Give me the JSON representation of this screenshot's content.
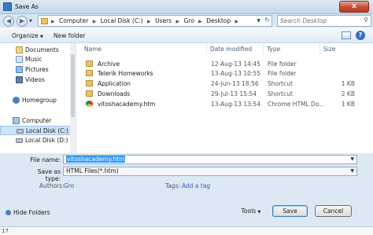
{
  "window": {
    "title": "Save As",
    "close_label": "x"
  },
  "address": {
    "crumbs": [
      "Computer",
      "Local Disk (C:)",
      "Users",
      "Gro",
      "Desktop"
    ],
    "search_placeholder": "Search Desktop"
  },
  "toolbar": {
    "organize_label": "Organize",
    "new_folder_label": "New folder",
    "help_label": "?"
  },
  "sidebar": {
    "items": [
      {
        "label": "Documents",
        "icon": "documents-icon"
      },
      {
        "label": "Music",
        "icon": "music-icon"
      },
      {
        "label": "Pictures",
        "icon": "pictures-icon"
      },
      {
        "label": "Videos",
        "icon": "videos-icon"
      },
      {
        "label": "Homegroup",
        "icon": "homegroup-icon"
      },
      {
        "label": "Computer",
        "icon": "computer-icon"
      },
      {
        "label": "Local Disk (C:)",
        "icon": "drive-icon"
      },
      {
        "label": "Local Disk (D:)",
        "icon": "drive-icon"
      }
    ]
  },
  "filelist": {
    "columns": [
      "Name",
      "Date modified",
      "Type",
      "Size"
    ],
    "rows": [
      {
        "name": "Archive",
        "date": "12-Aug-13 14:45",
        "type": "File folder",
        "size": "",
        "icon": "folder-icon"
      },
      {
        "name": "Telerik Homeworks",
        "date": "13-Aug-13 10:55",
        "type": "File folder",
        "size": "",
        "icon": "folder-icon"
      },
      {
        "name": "Application",
        "date": "24-Jun-13 18:56",
        "type": "Shortcut",
        "size": "1 KB",
        "icon": "shortcut-icon"
      },
      {
        "name": "Downloads",
        "date": "29-Jul-13 15:54",
        "type": "Shortcut",
        "size": "2 KB",
        "icon": "shortcut-icon"
      },
      {
        "name": "vitoshacademy.htm",
        "date": "13-Aug-13 13:54",
        "type": "Chrome HTML Do...",
        "size": "1 KB",
        "icon": "chrome-icon"
      }
    ]
  },
  "form": {
    "filename_label": "File name:",
    "filename_value": "vitoshacademy.htm",
    "savetype_label": "Save as type:",
    "savetype_value": "HTML Files(*.htm)",
    "authors_label": "Authors:",
    "authors_value": "Gro",
    "tags_label": "Tags:",
    "tags_value": "Add a tag",
    "hide_folders_label": "Hide Folders",
    "tools_label": "Tools",
    "save_label": "Save",
    "cancel_label": "Cancel",
    "row_number": "17"
  },
  "colors": {
    "accent": "#3399ff",
    "link": "#2d63b5",
    "close": "#c74b33"
  }
}
